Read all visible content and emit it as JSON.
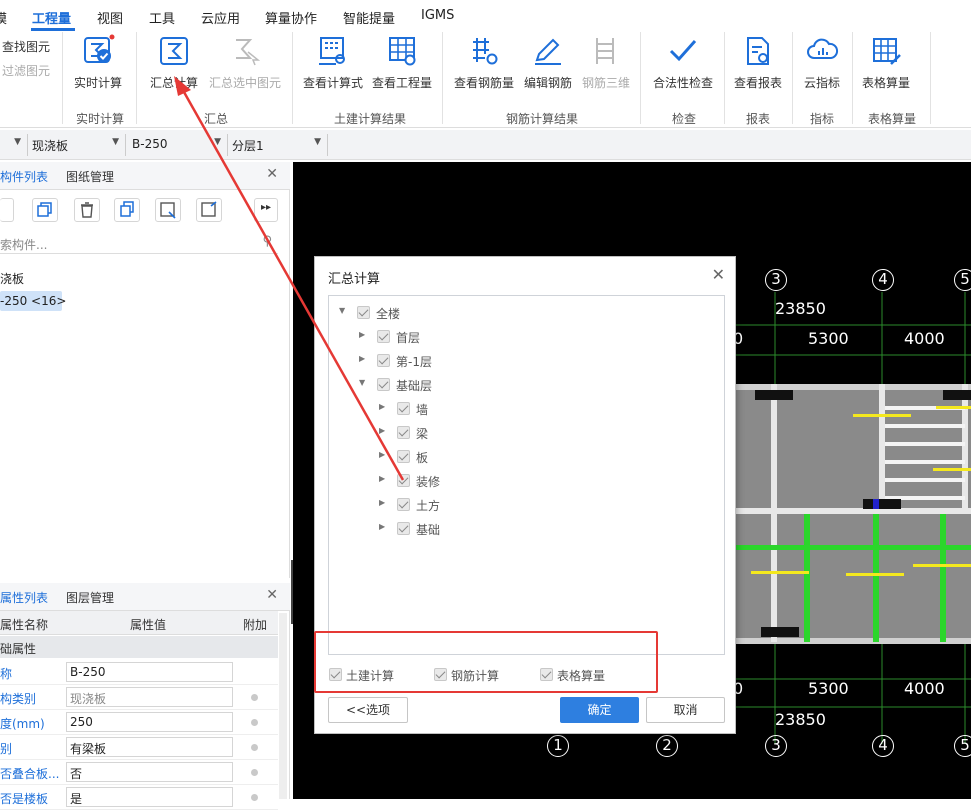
{
  "menubar": {
    "items": [
      "模",
      "工程量",
      "视图",
      "工具",
      "云应用",
      "算量协作",
      "智能提量",
      "IGMS"
    ],
    "active": "工程量"
  },
  "ribbon": {
    "find_items": [
      "查找图元",
      "过滤图元"
    ],
    "buttons": {
      "realtime": "实时计算",
      "summary_calc": "汇总计算",
      "summary_selected": "汇总选中图元",
      "view_formula": "查看计算式",
      "view_quantity": "查看工程量",
      "view_rebar_qty": "查看钢筋量",
      "edit_rebar": "编辑钢筋",
      "rebar_3d": "钢筋三维",
      "legality_check": "合法性检查",
      "view_report": "查看报表",
      "cloud_index": "云指标",
      "table_quantity": "表格算量"
    },
    "groups": {
      "realtime": "实时计算",
      "summary": "汇总",
      "civil_result": "土建计算结果",
      "rebar_result": "钢筋计算结果",
      "check": "检查",
      "report": "报表",
      "index": "指标",
      "table": "表格算量"
    }
  },
  "selectors": [
    "现浇板",
    "B-250",
    "分层1"
  ],
  "left_top": {
    "tabs": [
      "构件列表",
      "图纸管理"
    ],
    "search_placeholder": "索构件...",
    "tree": [
      "浇板",
      "-250 <16>"
    ]
  },
  "left_bottom": {
    "tabs": [
      "属性列表",
      "图层管理"
    ],
    "headers": [
      "属性名称",
      "属性值",
      "附加"
    ],
    "section": "础属性",
    "rows": [
      {
        "name": "称",
        "value": "B-250",
        "readonly": false,
        "dot": false
      },
      {
        "name": "构类别",
        "value": "现浇板",
        "readonly": true,
        "dot": true
      },
      {
        "name": "度(mm)",
        "value": "250",
        "readonly": false,
        "dot": true
      },
      {
        "name": "别",
        "value": "有梁板",
        "readonly": false,
        "dot": true
      },
      {
        "name": "否叠合板...",
        "value": "否",
        "readonly": false,
        "dot": true
      },
      {
        "name": "否是楼板",
        "value": "是",
        "readonly": false,
        "dot": true
      }
    ]
  },
  "canvas": {
    "top_labels": {
      "axis3": "3",
      "axis4": "4",
      "axis5": "5",
      "total": "23850",
      "span1": "5300",
      "span2": "4000",
      "partial": "0"
    },
    "bottom_labels": {
      "axis1": "1",
      "axis2": "2",
      "axis3": "3",
      "axis4": "4",
      "axis5": "5",
      "total": "23850",
      "span1": "5300",
      "span2": "4000",
      "partial": "0"
    }
  },
  "dialog": {
    "title": "汇总计算",
    "tree": [
      {
        "label": "全楼",
        "level": 0,
        "expanded": true
      },
      {
        "label": "首层",
        "level": 1,
        "expanded": false
      },
      {
        "label": "第-1层",
        "level": 1,
        "expanded": false
      },
      {
        "label": "基础层",
        "level": 1,
        "expanded": true
      },
      {
        "label": "墙",
        "level": 2,
        "expanded": false
      },
      {
        "label": "梁",
        "level": 2,
        "expanded": false
      },
      {
        "label": "板",
        "level": 2,
        "expanded": false
      },
      {
        "label": "装修",
        "level": 2,
        "expanded": false
      },
      {
        "label": "土方",
        "level": 2,
        "expanded": false
      },
      {
        "label": "基础",
        "level": 2,
        "expanded": false
      }
    ],
    "checkboxes": [
      "土建计算",
      "钢筋计算",
      "表格算量"
    ],
    "buttons": {
      "options": "<<选项",
      "ok": "确定",
      "cancel": "取消"
    }
  },
  "colors": {
    "accent": "#1e6fd9",
    "annotation": "#e53935",
    "primary_button": "#2e7fe0"
  }
}
